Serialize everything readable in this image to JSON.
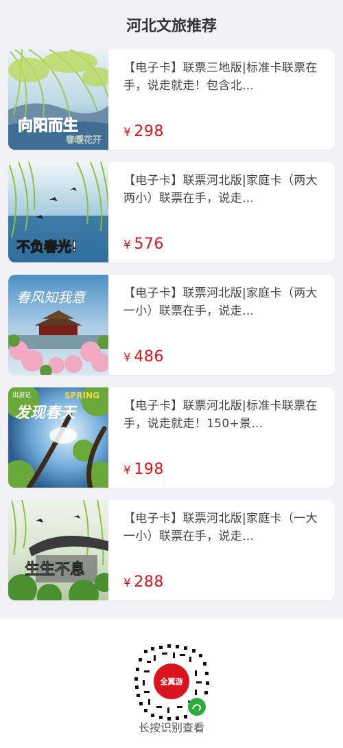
{
  "header": {
    "title": "河北文旅推荐"
  },
  "products": [
    {
      "title": "【电子卡】联票三地版|标准卡联票在手，说走就走！包含北…",
      "currency": "¥",
      "price": "298",
      "image": {
        "icon": "willow-lake-poster",
        "text_main": "向阳而生",
        "text_sub": "春暖花开"
      }
    },
    {
      "title": "【电子卡】联票河北版|家庭卡（两大两小）联票在手，说走…",
      "currency": "¥",
      "price": "576",
      "image": {
        "icon": "swallow-lake-poster",
        "text_main": "不负春光!"
      }
    },
    {
      "title": "【电子卡】联票河北版|家庭卡（两大一小）联票在手，说走…",
      "currency": "¥",
      "price": "486",
      "image": {
        "icon": "palace-blossom-poster",
        "text_main": "春风知我意"
      }
    },
    {
      "title": "【电子卡】联票河北版|标准卡联票在手，说走就走！150+景…",
      "currency": "¥",
      "price": "198",
      "image": {
        "icon": "spring-tree-poster",
        "text_main": "发现春天",
        "text_sub": "出游记",
        "text_en": "SPRING"
      }
    },
    {
      "title": "【电子卡】联票河北版|家庭卡（一大一小）联票在手，说走…",
      "currency": "¥",
      "price": "288",
      "image": {
        "icon": "pavilion-willow-poster",
        "text_main": "生生不息"
      }
    }
  ],
  "footer": {
    "qr_label": "全翼游",
    "hint": "长按识别查看"
  },
  "colors": {
    "price": "#d9141e",
    "background": "#f2f2f6",
    "card": "#ffffff"
  }
}
